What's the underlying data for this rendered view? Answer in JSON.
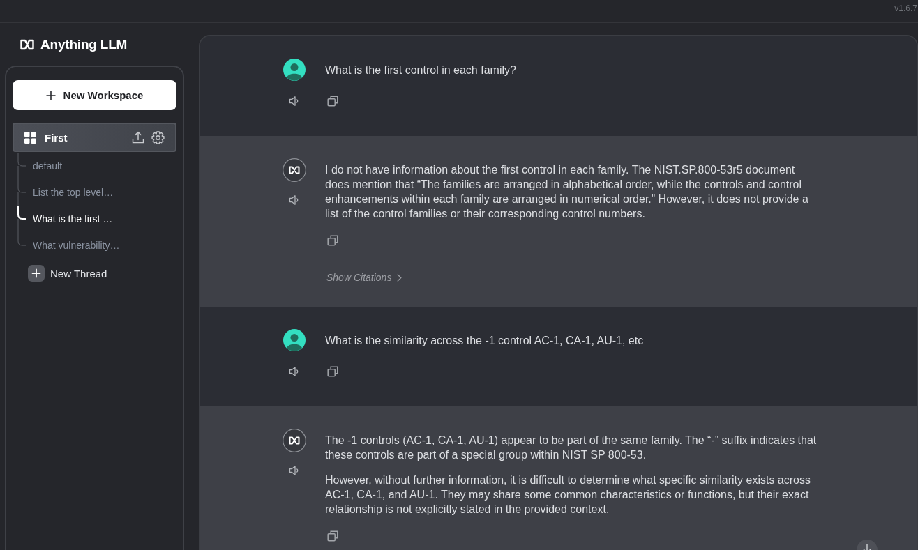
{
  "top_bar": {
    "version": "v1.6.7"
  },
  "sidebar": {
    "brand": "Anything LLM",
    "new_workspace_button": "New Workspace",
    "workspaces": [
      {
        "name": "First",
        "selected": true,
        "threads": [
          {
            "title": "default",
            "selected": false
          },
          {
            "title": "List the top level…",
            "selected": false
          },
          {
            "title": "What is the first …",
            "selected": true
          },
          {
            "title": "What vulnerability…",
            "selected": false
          }
        ]
      }
    ],
    "new_thread_button": "New Thread"
  },
  "chat": {
    "messages": [
      {
        "kind": "user",
        "paragraphs": [
          "What is the first control in each family?"
        ]
      },
      {
        "kind": "assistant",
        "paragraphs": [
          "I do not have information about the first control in each family. The NIST.SP.800-53r5 document does mention that “The families are arranged in alphabetical order, while the controls and control enhancements within each family are arranged in numerical order.” However, it does not provide a list of the control families or their corresponding control numbers."
        ],
        "citations_link": "Show Citations"
      },
      {
        "kind": "user",
        "paragraphs": [
          "What is the similarity across the -1 control AC-1, CA-1, AU-1, etc"
        ]
      },
      {
        "kind": "assistant",
        "paragraphs": [
          "The -1 controls (AC-1, CA-1, AU-1) appear to be part of the same family. The “-” suffix indicates that these controls are part of a special group within NIST SP 800-53.",
          "However, without further information, it is difficult to determine what specific similarity exists across AC-1, CA-1, and AU-1. They may share some common characteristics or functions, but their exact relationship is not explicitly stated in the provided context."
        ]
      }
    ]
  }
}
